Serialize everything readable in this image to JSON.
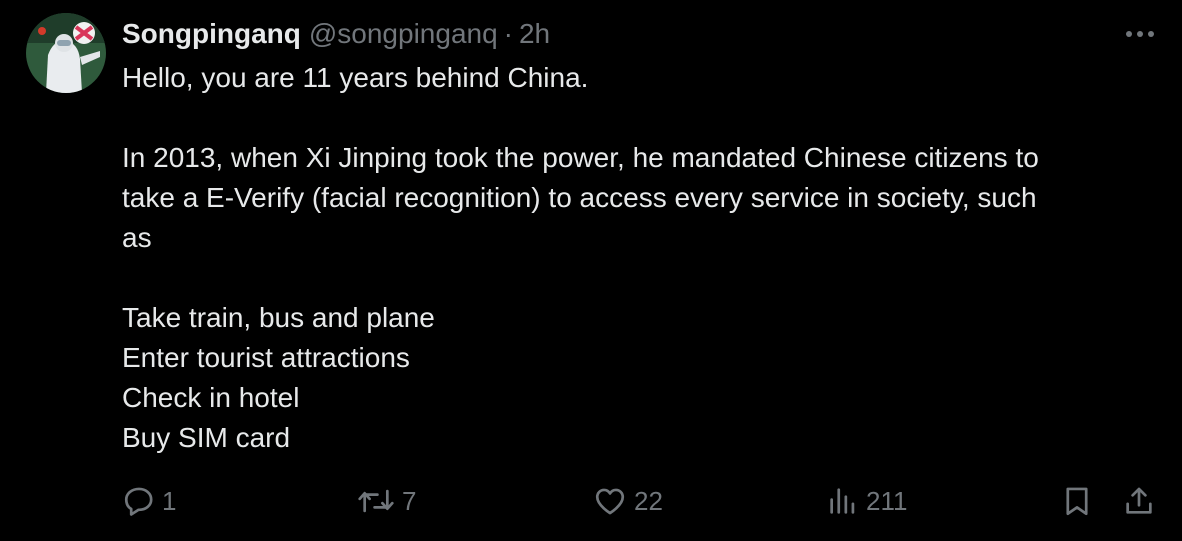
{
  "tweet": {
    "author": {
      "display_name": "Songpinganq",
      "handle": "@songpinganq",
      "separator": "·",
      "time": "2h",
      "avatar_icon": "profile-avatar"
    },
    "body": {
      "intro": "Hello, you are 11 years behind China.",
      "paragraph_line1": "In 2013, when Xi Jinping took the power, he mandated Chinese citizens to",
      "paragraph_line2": "take a E-Verify (facial recognition) to access every service in society, such",
      "paragraph_line3": "as",
      "list": [
        "Take train, bus and plane",
        "Enter tourist attractions",
        "Check in hotel",
        "Buy SIM card"
      ]
    },
    "actions": {
      "reply_count": "1",
      "repost_count": "7",
      "like_count": "22",
      "view_count": "211"
    },
    "icons": {
      "more": "more-icon",
      "reply": "reply-icon",
      "repost": "repost-icon",
      "like": "heart-icon",
      "views": "views-icon",
      "bookmark": "bookmark-icon",
      "share": "share-icon"
    }
  },
  "colors": {
    "background": "#000000",
    "primary_text": "#e7e9ea",
    "secondary_text": "#71767b"
  }
}
